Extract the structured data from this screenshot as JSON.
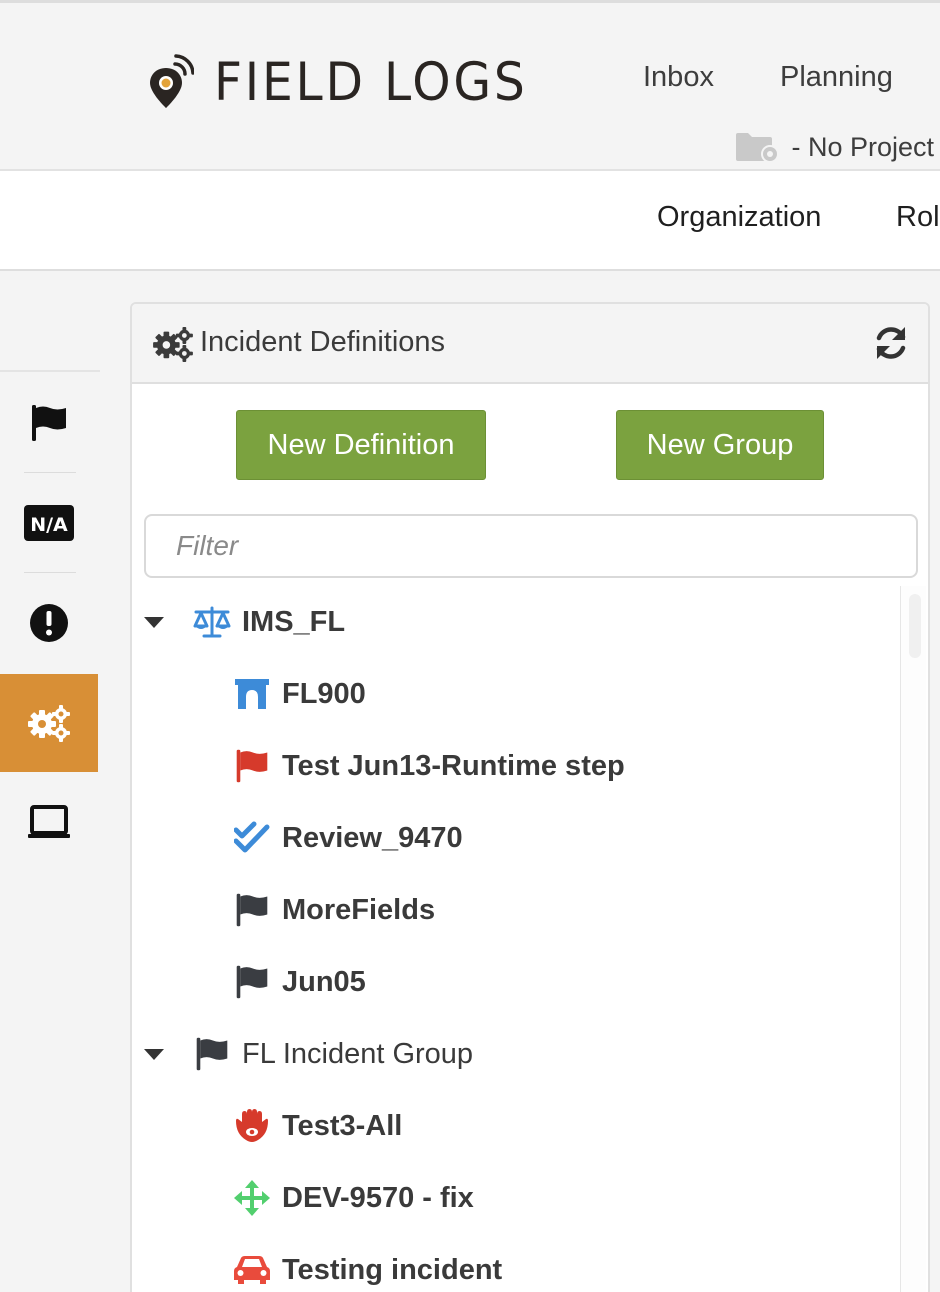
{
  "header": {
    "logo_text": "FIELD LOGS",
    "nav": [
      "Inbox",
      "Planning"
    ],
    "project_label": "- No Project"
  },
  "subnav": {
    "items": [
      "Organization",
      "Rol"
    ]
  },
  "sidebar": {
    "items": [
      {
        "icon": "flag-icon"
      },
      {
        "icon": "na-icon",
        "text": "N/A"
      },
      {
        "icon": "alert-circle-icon"
      },
      {
        "icon": "gears-icon",
        "active": true
      },
      {
        "icon": "laptop-icon"
      }
    ],
    "active_color": "#d88f36"
  },
  "panel": {
    "title": "Incident Definitions",
    "new_definition_label": "New Definition",
    "new_group_label": "New Group",
    "filter_placeholder": "Filter",
    "button_color": "#7ba23f"
  },
  "tree": {
    "groups": [
      {
        "label": "IMS_FL",
        "icon": "balance-scale-icon",
        "items": [
          {
            "label": "FL900",
            "icon": "archway-icon"
          },
          {
            "label": "Test Jun13-Runtime step",
            "icon": "flag-icon-red"
          },
          {
            "label": "Review_9470",
            "icon": "double-check-icon"
          },
          {
            "label": "MoreFields",
            "icon": "flag-icon"
          },
          {
            "label": "Jun05",
            "icon": "flag-icon"
          }
        ]
      },
      {
        "label": "FL Incident Group",
        "icon": "flag-icon",
        "items": [
          {
            "label": "Test3-All",
            "icon": "hamsa-icon"
          },
          {
            "label": "DEV-9570 - fix",
            "icon": "arrows-move-icon"
          },
          {
            "label": "Testing incident",
            "icon": "car-icon"
          }
        ]
      }
    ]
  }
}
